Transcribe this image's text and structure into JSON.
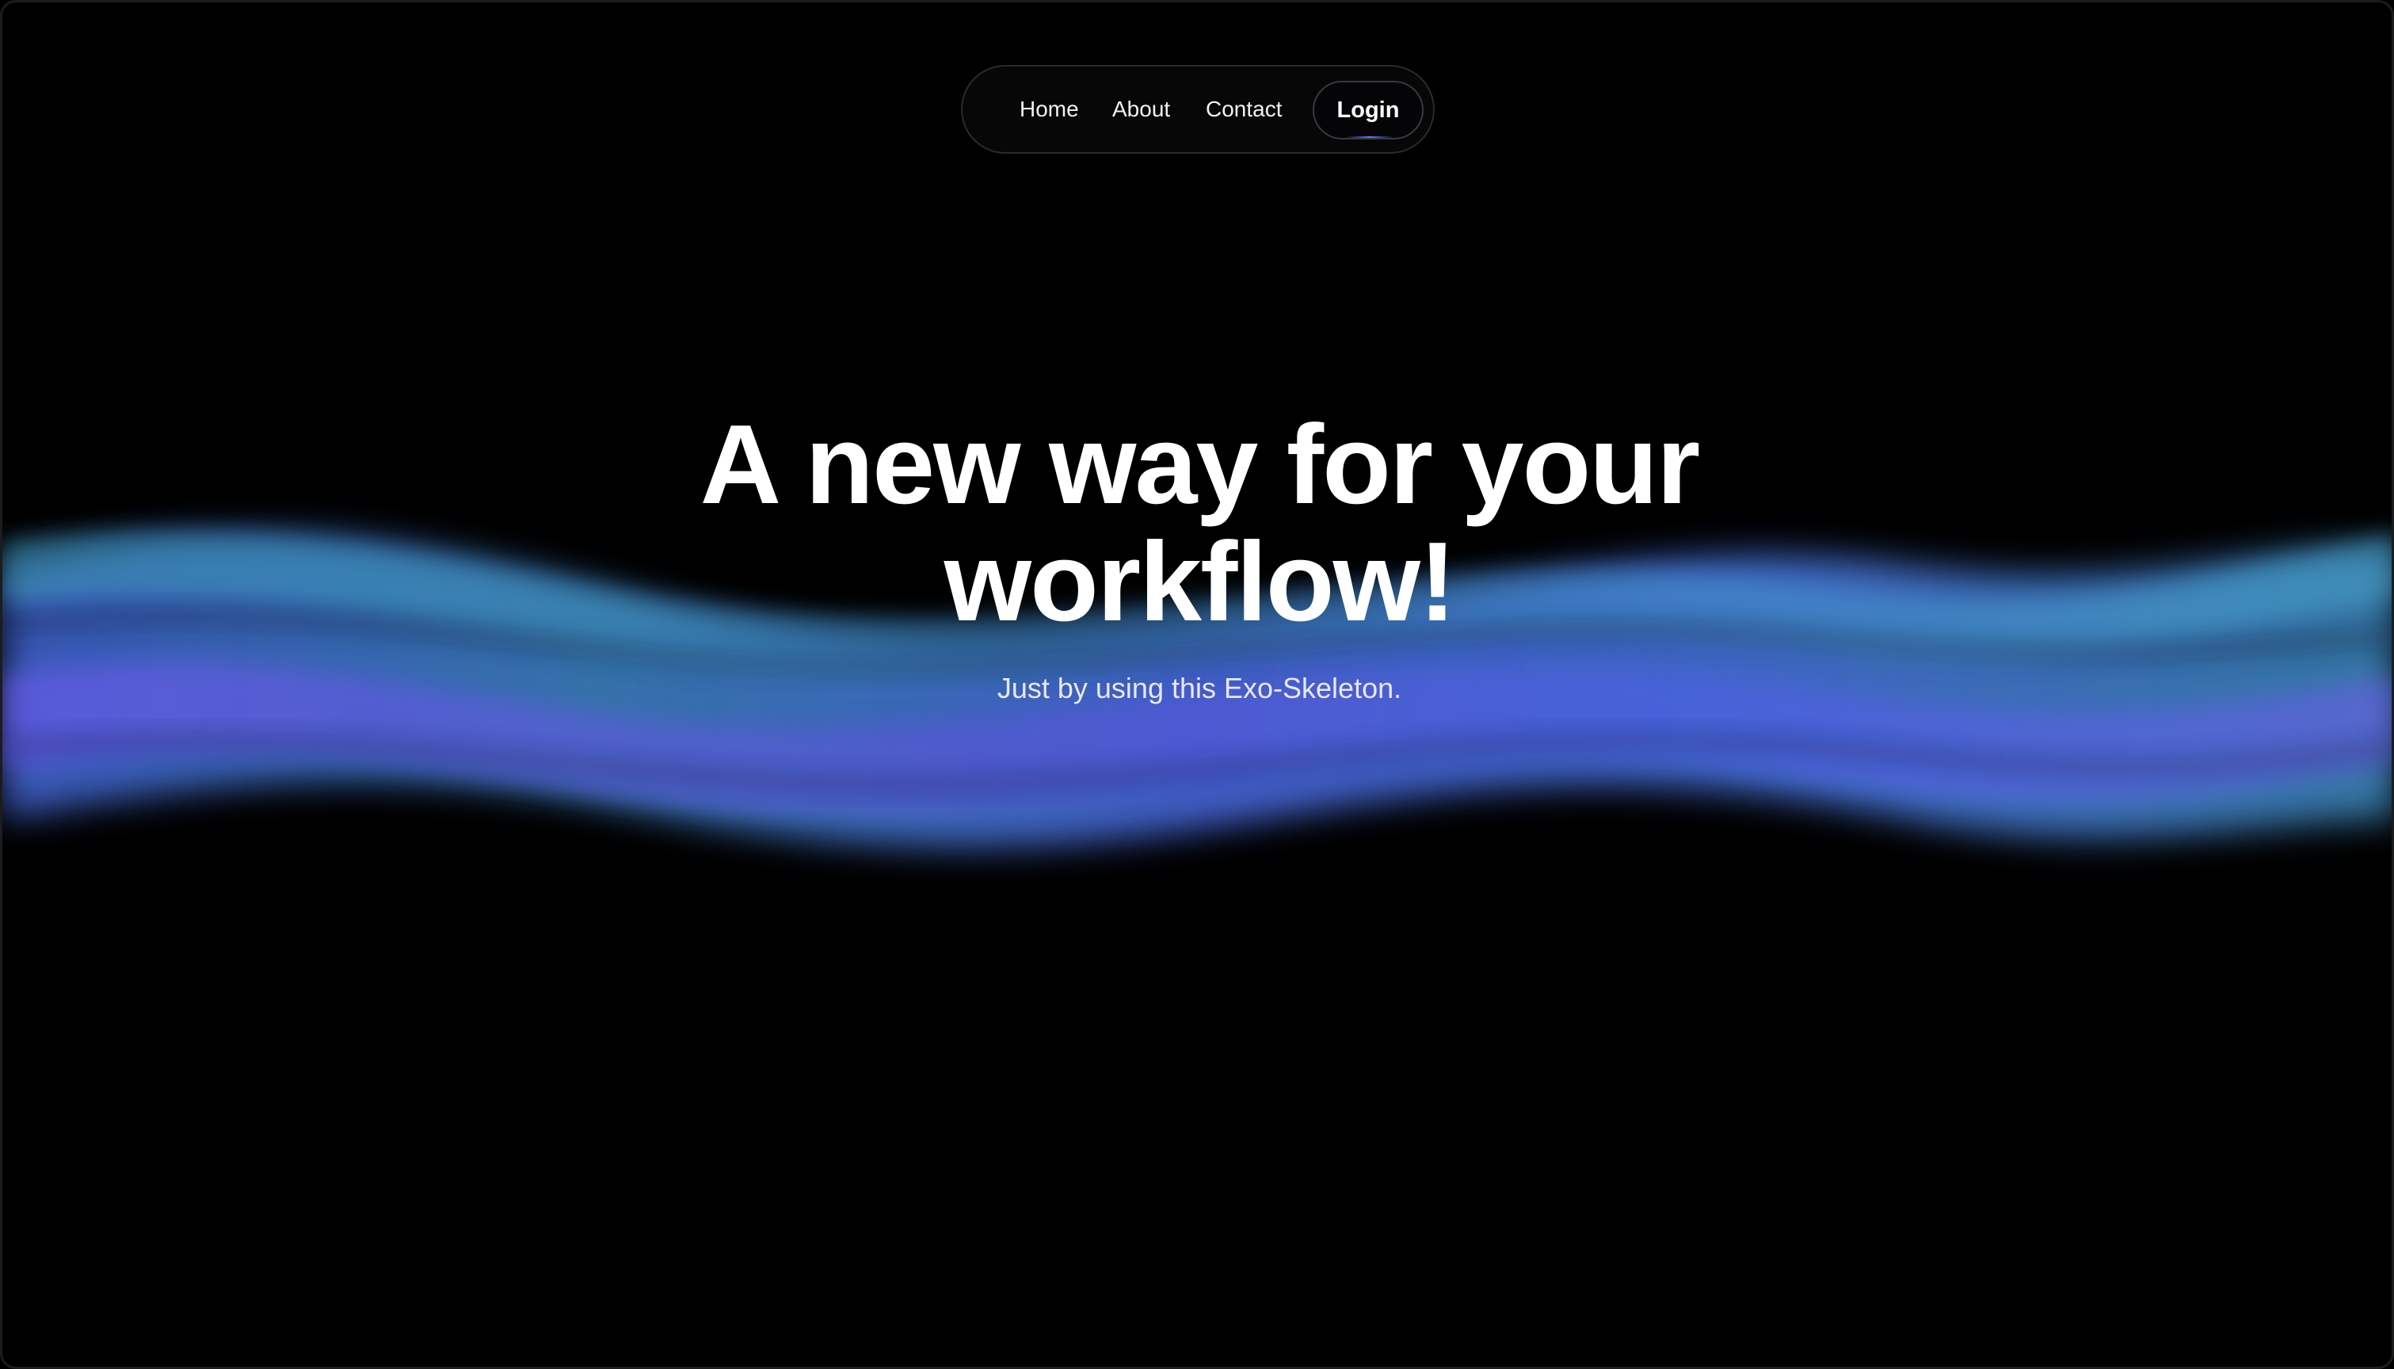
{
  "nav": {
    "home_label": "Home",
    "about_label": "About",
    "contact_label": "Contact",
    "login_label": "Login"
  },
  "hero": {
    "title": "A new way for your workflow!",
    "subtitle": "Just by using this Exo-Skeleton."
  },
  "colors": {
    "background": "#000000",
    "wave_blue": "#4a6ee0",
    "wave_teal": "#3f8fb8",
    "wave_violet": "#6a5be8",
    "text": "#ffffff"
  }
}
